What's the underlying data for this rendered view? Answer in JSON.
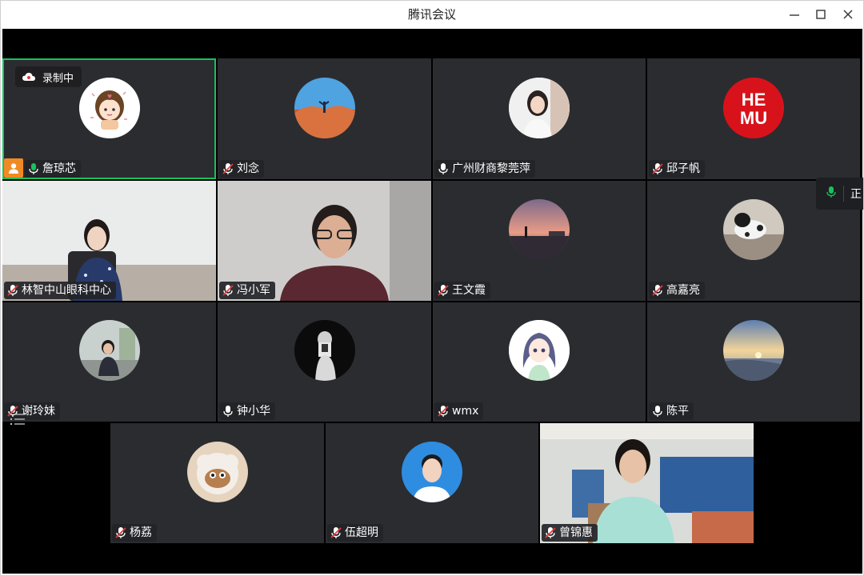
{
  "window": {
    "title": "腾讯会议",
    "controls": [
      "minimize-icon",
      "maximize-icon",
      "close-icon"
    ]
  },
  "recording": {
    "label": "录制中",
    "icon": "cloud-icon"
  },
  "speaking_indicator": {
    "text": "正",
    "icon": "mic-active-icon"
  },
  "participants": [
    {
      "name": "詹琼芯",
      "mic": "on",
      "host": true,
      "active": true,
      "type": "avatar"
    },
    {
      "name": "刘念",
      "mic": "muted",
      "type": "avatar"
    },
    {
      "name": "广州财商黎莞萍",
      "mic": "on",
      "type": "avatar"
    },
    {
      "name": "邱子帆",
      "mic": "muted",
      "type": "avatar",
      "avatar_text": "HE MU"
    },
    {
      "name": "林智中山眼科中心",
      "mic": "muted",
      "type": "video"
    },
    {
      "name": "冯小军",
      "mic": "muted",
      "type": "video"
    },
    {
      "name": "王文霞",
      "mic": "muted",
      "type": "avatar"
    },
    {
      "name": "高嘉亮",
      "mic": "muted",
      "type": "avatar"
    },
    {
      "name": "谢玲妹",
      "mic": "muted",
      "type": "avatar"
    },
    {
      "name": "钟小华",
      "mic": "on",
      "type": "avatar"
    },
    {
      "name": "wmx",
      "mic": "muted",
      "type": "avatar"
    },
    {
      "name": "陈平",
      "mic": "on",
      "type": "avatar"
    },
    {
      "name": "杨荔",
      "mic": "muted",
      "type": "avatar"
    },
    {
      "name": "伍超明",
      "mic": "muted",
      "type": "avatar"
    },
    {
      "name": "曾锦惠",
      "mic": "muted",
      "type": "video"
    }
  ],
  "colors": {
    "active_border": "#19c25b",
    "tile_bg": "#2b2c30",
    "host_badge": "#f08a24",
    "mic_on": "#ffffff",
    "mic_speaking": "#19c25b",
    "mic_muted_slash": "#e23b3b"
  }
}
